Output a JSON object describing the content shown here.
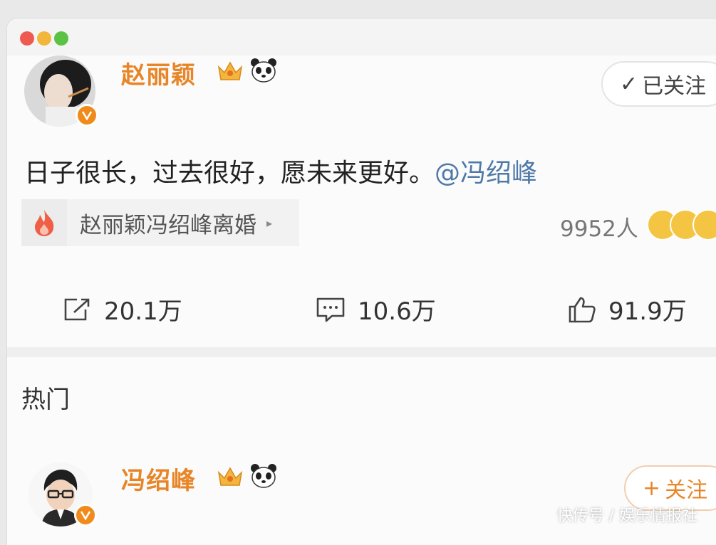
{
  "post": {
    "author": "赵丽颖",
    "follow_label": "已关注",
    "follow_mark": "✓",
    "text": "日子很长，过去很好，愿未来更好。",
    "mention": "@冯绍峰",
    "topic": "赵丽颖冯绍峰离婚",
    "topic_arrow": "▸",
    "people_count": "9952人",
    "repost_count": "20.1万",
    "comment_count": "10.6万",
    "like_count": "91.9万"
  },
  "section": {
    "title": "热门",
    "chevron": "›"
  },
  "comment": {
    "author": "冯绍峰",
    "follow_label": "关注",
    "follow_mark": "+"
  },
  "watermark": "快传号 / 娱乐情报社",
  "colors": {
    "username": "#e88526",
    "mention": "#4f79a8",
    "verified_badge": "#f08a1a"
  },
  "icons": [
    "crown-icon",
    "panda-icon",
    "fire-icon",
    "repost-icon",
    "comment-icon",
    "like-icon",
    "chevron-right-icon"
  ]
}
